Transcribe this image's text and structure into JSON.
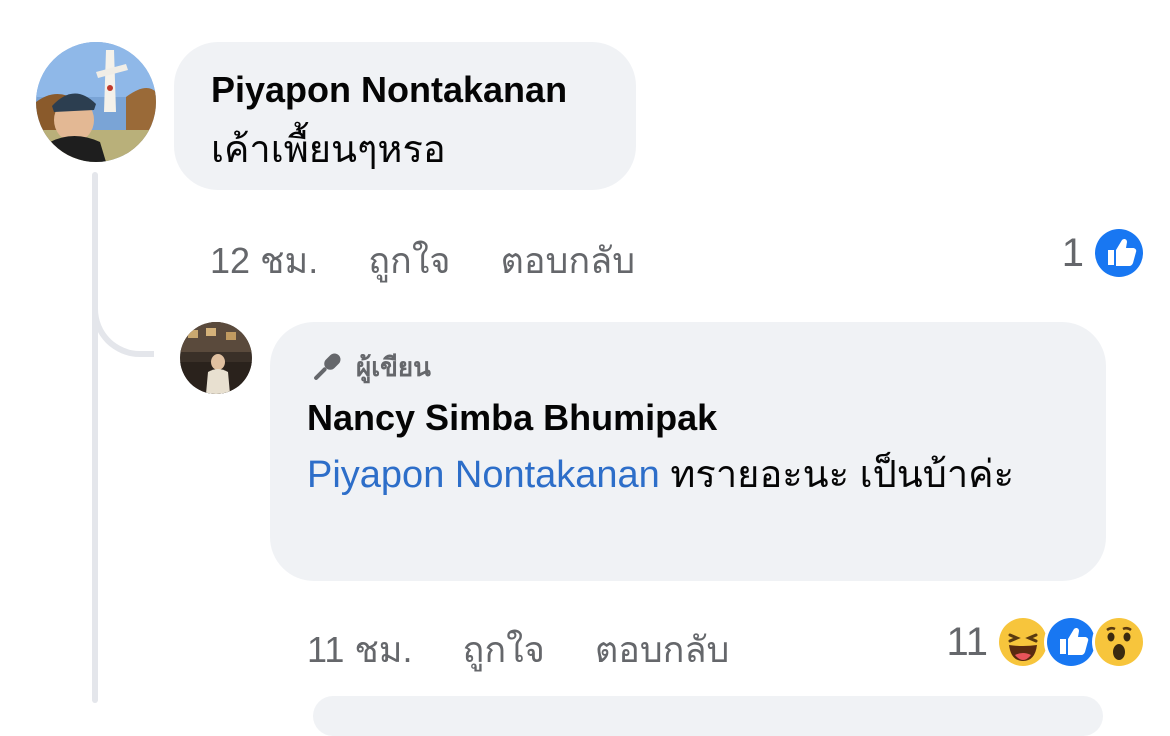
{
  "comments": [
    {
      "author": "Piyapon Nontakanan",
      "text": "เค้าเพื้ยนๆหรอ",
      "time": "12 ชม.",
      "like_label": "ถูกใจ",
      "reply_label": "ตอบกลับ",
      "reaction_count": "1",
      "reactions": [
        "like-icon"
      ]
    },
    {
      "badge": "ผู้เขียน",
      "author": "Nancy Simba Bhumipak",
      "mention": "Piyapon Nontakanan",
      "text": " ทรายอะนะ เป็นบ้าค่ะ",
      "time": "11 ชม.",
      "like_label": "ถูกใจ",
      "reply_label": "ตอบกลับ",
      "reaction_count": "11",
      "reactions": [
        "haha-icon",
        "like-icon",
        "wow-icon"
      ]
    }
  ],
  "colors": {
    "bubble": "#f0f2f5",
    "meta_text": "#65676b",
    "mention": "#2d6ec9",
    "like_blue": "#1877f2",
    "thread_line": "#e4e6eb"
  }
}
